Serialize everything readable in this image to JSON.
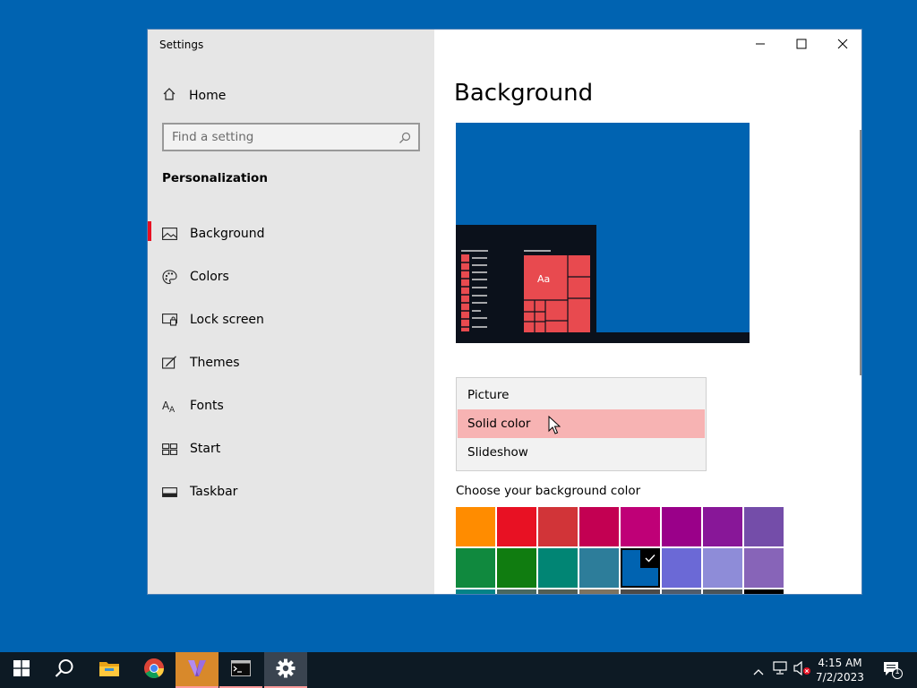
{
  "window": {
    "title": "Settings"
  },
  "sidebar": {
    "home_label": "Home",
    "search_placeholder": "Find a setting",
    "section_title": "Personalization",
    "items": [
      {
        "label": "Background",
        "icon": "image-icon",
        "active": true
      },
      {
        "label": "Colors",
        "icon": "palette-icon",
        "active": false
      },
      {
        "label": "Lock screen",
        "icon": "lock-screen-icon",
        "active": false
      },
      {
        "label": "Themes",
        "icon": "themes-icon",
        "active": false
      },
      {
        "label": "Fonts",
        "icon": "fonts-icon",
        "active": false
      },
      {
        "label": "Start",
        "icon": "start-icon",
        "active": false
      },
      {
        "label": "Taskbar",
        "icon": "taskbar-icon",
        "active": false
      }
    ]
  },
  "content": {
    "page_title": "Background",
    "preview": {
      "tile_text": "Aa",
      "background_color": "#0063b1",
      "accent_color": "#e84a4f"
    },
    "dropdown": {
      "options": [
        "Picture",
        "Solid color",
        "Slideshow"
      ],
      "highlighted": "Solid color"
    },
    "choose_color_label": "Choose your background color",
    "swatch_rows": [
      [
        "#ff8c00",
        "#e81123",
        "#d13438",
        "#c30052",
        "#bf0077",
        "#9a0089",
        "#881798",
        "#744da9"
      ],
      [
        "#10893e",
        "#107c10",
        "#018574",
        "#2d7d9a",
        "#0063b1",
        "#6b69d6",
        "#8e8cd8",
        "#8764b8"
      ],
      [
        "#038387",
        "#486860",
        "#525e54",
        "#7e735f",
        "#4c4a48",
        "#515c6b",
        "#4a5459",
        "#000000"
      ]
    ],
    "selected_swatch": "#0063b1"
  },
  "taskbar": {
    "clock_time": "4:15 AM",
    "clock_date": "7/2/2023",
    "notification_count": "1",
    "apps": [
      "start-icon",
      "search-icon",
      "file-explorer-icon",
      "chrome-icon",
      "visual-studio-icon",
      "terminal-icon",
      "settings-gear-icon"
    ]
  }
}
